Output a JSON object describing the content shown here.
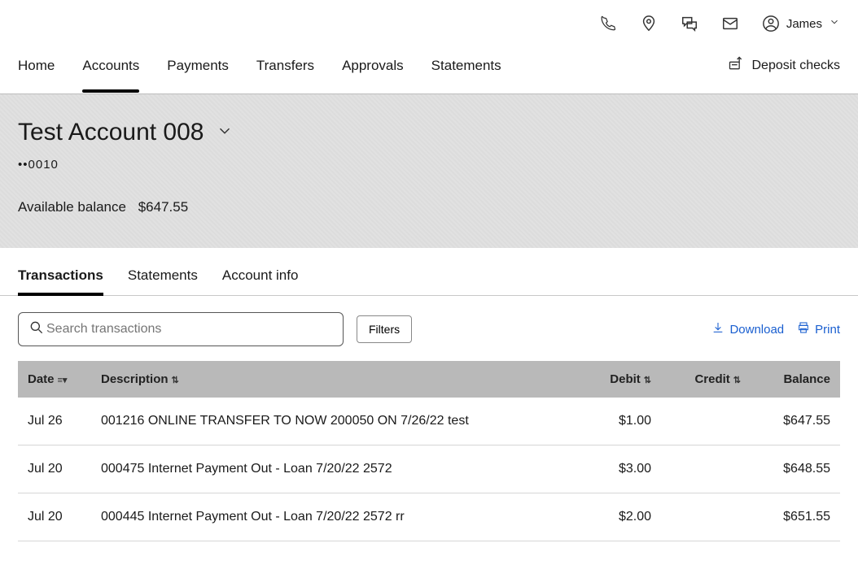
{
  "header": {
    "user_name": "James"
  },
  "nav": {
    "items": [
      "Home",
      "Accounts",
      "Payments",
      "Transfers",
      "Approvals",
      "Statements"
    ],
    "active_index": 1,
    "deposit_label": "Deposit checks"
  },
  "account": {
    "title": "Test Account 008",
    "mask": "••0010",
    "balance_label": "Available balance",
    "balance_value": "$647.55"
  },
  "tabs": {
    "items": [
      "Transactions",
      "Statements",
      "Account info"
    ],
    "active_index": 0
  },
  "toolbar": {
    "search_placeholder": "Search transactions",
    "filters_label": "Filters",
    "download_label": "Download",
    "print_label": "Print"
  },
  "table": {
    "columns": {
      "date": "Date",
      "description": "Description",
      "debit": "Debit",
      "credit": "Credit",
      "balance": "Balance"
    },
    "rows": [
      {
        "date": "Jul 26",
        "description": "001216 ONLINE TRANSFER TO NOW 200050 ON 7/26/22 test",
        "debit": "$1.00",
        "credit": "",
        "balance": "$647.55"
      },
      {
        "date": "Jul 20",
        "description": "000475 Internet Payment Out - Loan 7/20/22 2572",
        "debit": "$3.00",
        "credit": "",
        "balance": "$648.55"
      },
      {
        "date": "Jul 20",
        "description": "000445 Internet Payment Out - Loan 7/20/22 2572 rr",
        "debit": "$2.00",
        "credit": "",
        "balance": "$651.55"
      }
    ]
  }
}
